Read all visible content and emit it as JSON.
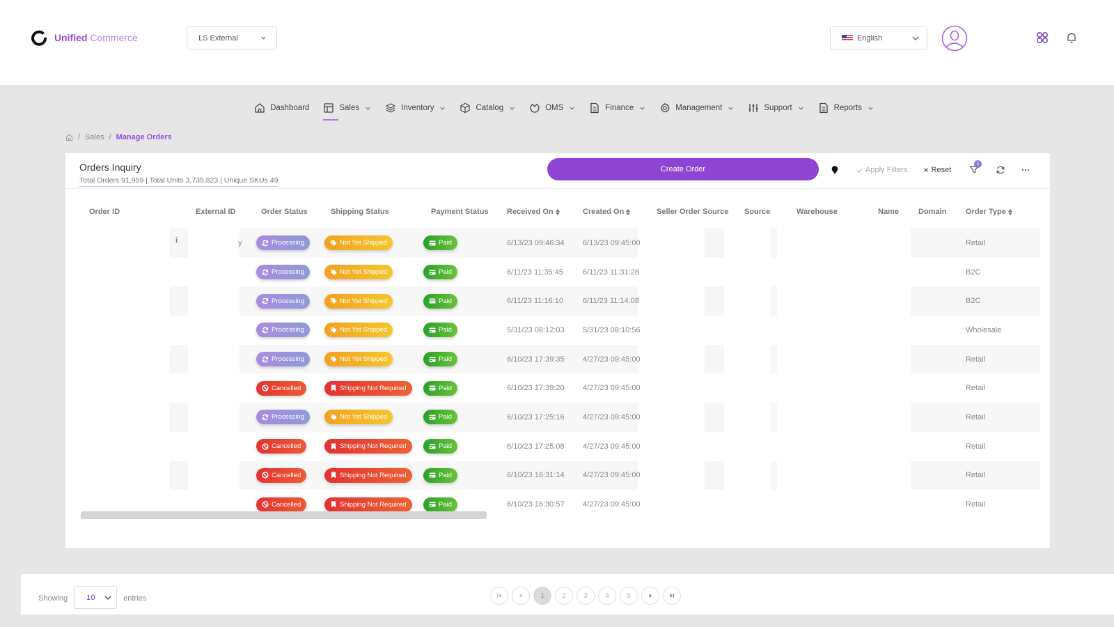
{
  "header": {
    "logo_bold": "Unified",
    "logo_light": "Commerce",
    "workspace_select": "LS External",
    "language_select": "English"
  },
  "nav": [
    {
      "label": "Dashboard",
      "icon": "home-icon",
      "has_menu": false,
      "active": false
    },
    {
      "label": "Sales",
      "icon": "layout-icon",
      "has_menu": true,
      "active": true
    },
    {
      "label": "Inventory",
      "icon": "layers-icon",
      "has_menu": true,
      "active": false
    },
    {
      "label": "Catalog",
      "icon": "box-icon",
      "has_menu": true,
      "active": false
    },
    {
      "label": "OMS",
      "icon": "basket-icon",
      "has_menu": true,
      "active": false
    },
    {
      "label": "Finance",
      "icon": "document-icon",
      "has_menu": true,
      "active": false
    },
    {
      "label": "Management",
      "icon": "gear-icon",
      "has_menu": true,
      "active": false
    },
    {
      "label": "Support",
      "icon": "sliders-icon",
      "has_menu": true,
      "active": false
    },
    {
      "label": "Reports",
      "icon": "report-icon",
      "has_menu": true,
      "active": false
    }
  ],
  "breadcrumb": {
    "items": [
      "Sales"
    ],
    "current": "Manage Orders",
    "separator": "/"
  },
  "card": {
    "title": "Orders Inquiry",
    "summary": "Total Orders 91,959 | Total Units 3,735,823 | Unique SKUs 49",
    "create_button": "Create Order",
    "apply_filters": "Apply Filters",
    "reset": "Reset",
    "filter_count": "1"
  },
  "table": {
    "columns": [
      {
        "label": "Order ID",
        "sortable": false
      },
      {
        "label": "External ID",
        "sortable": false
      },
      {
        "label": "Order Status",
        "sortable": false
      },
      {
        "label": "Shipping Status",
        "sortable": false
      },
      {
        "label": "Payment Status",
        "sortable": false
      },
      {
        "label": "Received On",
        "sortable": true
      },
      {
        "label": "Created On",
        "sortable": true
      },
      {
        "label": "Seller Order Source",
        "sortable": false
      },
      {
        "label": "Source",
        "sortable": false
      },
      {
        "label": "Warehouse",
        "sortable": false
      },
      {
        "label": "Name",
        "sortable": false
      },
      {
        "label": "Domain",
        "sortable": false
      },
      {
        "label": "Order Type",
        "sortable": true
      }
    ],
    "rows": [
      {
        "info": "i",
        "external_tail": "y",
        "order_status": "Processing",
        "shipping_status": "Not Yet Shipped",
        "payment_status": "Paid",
        "received_on": "6/13/23 09:46:34",
        "created_on": "6/13/23 09:45:00",
        "order_type": "Retail"
      },
      {
        "info": "",
        "external_tail": "",
        "order_status": "Processing",
        "shipping_status": "Not Yet Shipped",
        "payment_status": "Paid",
        "received_on": "6/11/23 11:35:45",
        "created_on": "6/11/23 11:31:28",
        "order_type": "B2C"
      },
      {
        "info": "",
        "external_tail": "",
        "order_status": "Processing",
        "shipping_status": "Not Yet Shipped",
        "payment_status": "Paid",
        "received_on": "6/11/23 11:16:10",
        "created_on": "6/11/23 11:14:08",
        "order_type": "B2C"
      },
      {
        "info": "",
        "external_tail": "",
        "order_status": "Processing",
        "shipping_status": "Not Yet Shipped",
        "payment_status": "Paid",
        "received_on": "5/31/23 08:12:03",
        "created_on": "5/31/23 08:10:56",
        "order_type": "Wholesale"
      },
      {
        "info": "",
        "external_tail": "",
        "order_status": "Processing",
        "shipping_status": "Not Yet Shipped",
        "payment_status": "Paid",
        "received_on": "6/10/23 17:39:35",
        "created_on": "4/27/23 09:45:00",
        "order_type": "Retail"
      },
      {
        "info": "",
        "external_tail": "",
        "order_status": "Cancelled",
        "shipping_status": "Shipping Not Required",
        "payment_status": "Paid",
        "received_on": "6/10/23 17:39:20",
        "created_on": "4/27/23 09:45:00",
        "order_type": "Retail"
      },
      {
        "info": "",
        "external_tail": "",
        "order_status": "Processing",
        "shipping_status": "Not Yet Shipped",
        "payment_status": "Paid",
        "received_on": "6/10/23 17:25:16",
        "created_on": "4/27/23 09:45:00",
        "order_type": "Retail"
      },
      {
        "info": "",
        "external_tail": "",
        "order_status": "Cancelled",
        "shipping_status": "Shipping Not Required",
        "payment_status": "Paid",
        "received_on": "6/10/23 17:25:08",
        "created_on": "4/27/23 09:45:00",
        "order_type": "Retail"
      },
      {
        "info": "",
        "external_tail": "",
        "order_status": "Cancelled",
        "shipping_status": "Shipping Not Required",
        "payment_status": "Paid",
        "received_on": "6/10/23 16:31:14",
        "created_on": "4/27/23 09:45:00",
        "order_type": "Retail"
      },
      {
        "info": "",
        "external_tail": "",
        "order_status": "Cancelled",
        "shipping_status": "Shipping Not Required",
        "payment_status": "Paid",
        "received_on": "6/10/23 16:30:57",
        "created_on": "4/27/23 09:45:00",
        "order_type": "Retail"
      }
    ]
  },
  "footer": {
    "showing_label": "Showing",
    "page_size": "10",
    "entries_label": "entries",
    "pages": [
      "1",
      "2",
      "3",
      "4",
      "5"
    ],
    "current_page": "1"
  },
  "colors": {
    "brand": "#8f44d3",
    "processing": "#a98be0",
    "not_yet_shipped": "#f2a123",
    "cancelled": "#e43232",
    "paid": "#2aa12a"
  }
}
